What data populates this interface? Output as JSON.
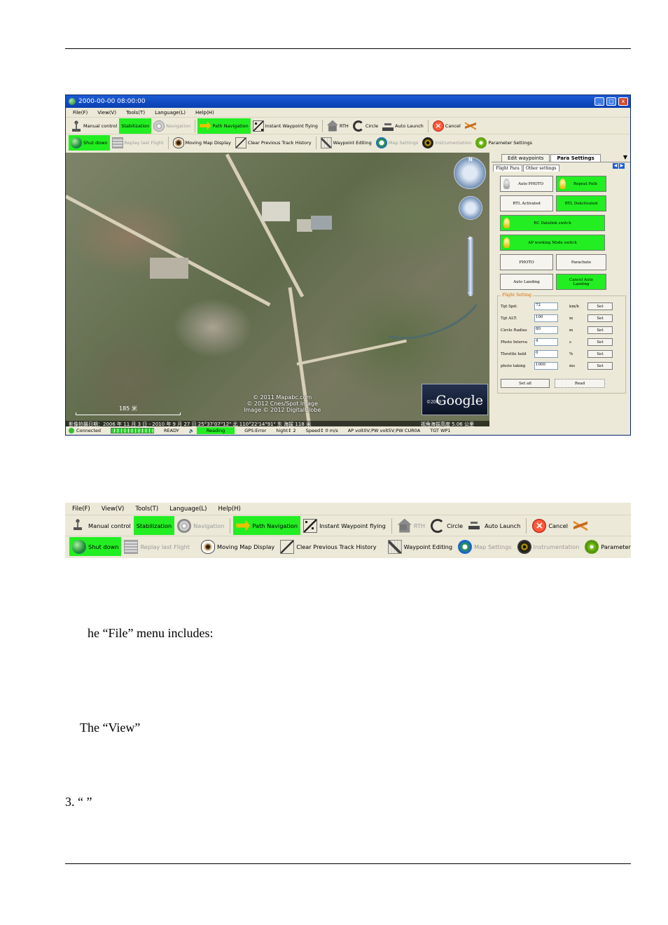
{
  "window": {
    "title": "2000-00-00 08:00:00",
    "min_label": "_",
    "max_label": "□",
    "close_label": "x"
  },
  "menu": [
    "File(F)",
    "View(V)",
    "Tools(T)",
    "Language(L)",
    "Help(H)"
  ],
  "toolbar": {
    "manual_control": "Manual control",
    "stabilization": "Stabilization",
    "navigation": "Navigation",
    "path_navigation": "Path Navigation",
    "instant_waypoint": "Instant Waypoint flying",
    "rth": "RTH",
    "circle": "Circle",
    "auto_launch": "Auto Launch",
    "cancel": "Cancel",
    "shut_down": "Shut down",
    "replay": "Replay last Flight",
    "moving_map": "Moving Map Display",
    "clear_track": "Clear Previous Track History",
    "waypoint_editing": "Waypoint Editing",
    "map_settings": "Map Settings",
    "instrumentation": "Instrumentation",
    "parameter_settings": "Parameter Settings"
  },
  "map": {
    "compass_n": "N",
    "zoom_plus": "+",
    "zoom_minus": "−",
    "copyright": [
      "© 2011 Mapabc.com",
      "© 2012 Cnes/Spot Image",
      "Image © 2012 DigitalGlobe"
    ],
    "google": "Google",
    "google_year": "©2009",
    "scale": "185 米",
    "info": "影像拍摄日期：2006 年 11 月 3 日 - 2010 年 9 月 27 日  25°37'07\"12\" 北  110°22'14\"91\" 东  海拔 118 米",
    "info_right": "视角海拔高度  5.06 公里"
  },
  "panel": {
    "tab_edit": "Edit waypoints",
    "tab_para": "Para Settings",
    "subtab_flight": "Flight Para",
    "subtab_other": "Other settings",
    "buttons": {
      "auto_photo": "Auto PHOTO",
      "repeat_path": "Repeat Path",
      "rtl_activated": "RTL Activated",
      "rtl_deactivated": "RTL Dekctivated",
      "rc_datalink": "RC Datalink  switch",
      "ap_working": "AP working Mode switch",
      "photo": "PHOTO",
      "parachute": "Parachute",
      "auto_landing": "Auto Landing",
      "cancel_auto_landing": "Cancel Auto Landing"
    },
    "flight_setting": {
      "legend": "Flight Setting",
      "rows": [
        {
          "label": "Tgt Spd:",
          "value": "72",
          "unit": "km/h",
          "set": "Set"
        },
        {
          "label": "Tgt ALT:",
          "value": "100",
          "unit": "m",
          "set": "Set"
        },
        {
          "label": "Circle Radius",
          "value": "80",
          "unit": "m",
          "set": "Set"
        },
        {
          "label": "Photo Interva",
          "value": "4",
          "unit": "s",
          "set": "Set"
        },
        {
          "label": "Throttle hold",
          "value": "0",
          "unit": "%",
          "set": "Set"
        },
        {
          "label": "photo taking",
          "value": "1000",
          "unit": "ms",
          "set": "Set"
        }
      ],
      "set_all": "Set all",
      "read": "Read"
    }
  },
  "status": {
    "connected": "Connected",
    "ready": "READY",
    "reading": "Reading",
    "gps": "GPS:Error",
    "height": "hight↕ 2",
    "speed": "Speed↕ 0 m/s",
    "ap": "AP volt0V;PW volt5V;PW CUR0A",
    "tgt": "TGT WP1"
  },
  "text": {
    "file_menu": "he “File” menu includes:",
    "view": "The “View”",
    "item3": "3. “      ”"
  },
  "colors": {
    "active_green": "#22ee22",
    "titlebar_blue": "#1c5bd6",
    "window_bg": "#ece9d8"
  }
}
